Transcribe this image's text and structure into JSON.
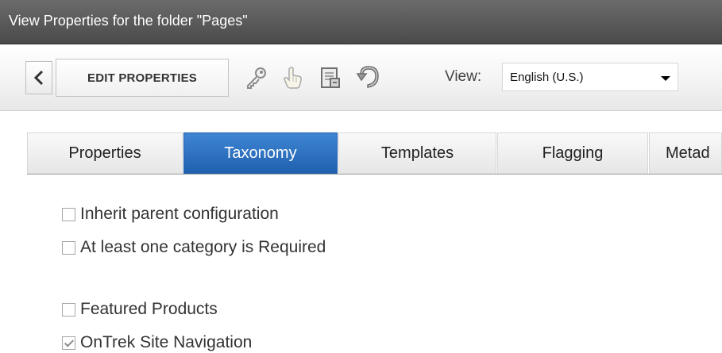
{
  "window": {
    "title": "View Properties for the folder \"Pages\""
  },
  "toolbar": {
    "back_icon": "chevron-left-icon",
    "edit_label": "EDIT PROPERTIES",
    "icons": [
      "key-icon",
      "hand-pointer-icon",
      "document-icon",
      "undo-icon"
    ],
    "view_label": "View:",
    "view_value": "English (U.S.)"
  },
  "tabs": [
    {
      "label": "Properties",
      "active": false
    },
    {
      "label": "Taxonomy",
      "active": true
    },
    {
      "label": "Templates",
      "active": false
    },
    {
      "label": "Flagging",
      "active": false
    },
    {
      "label": "Metad",
      "active": false
    }
  ],
  "options": [
    {
      "label": "Inherit parent configuration",
      "checked": false
    },
    {
      "label": "At least one category is Required",
      "checked": false
    }
  ],
  "taxonomies": [
    {
      "label": "Featured Products",
      "checked": false
    },
    {
      "label": "OnTrek Site Navigation",
      "checked": true
    }
  ],
  "colors": {
    "titlebar": "#4a4a4a",
    "active_tab": "#2b6fc0"
  }
}
